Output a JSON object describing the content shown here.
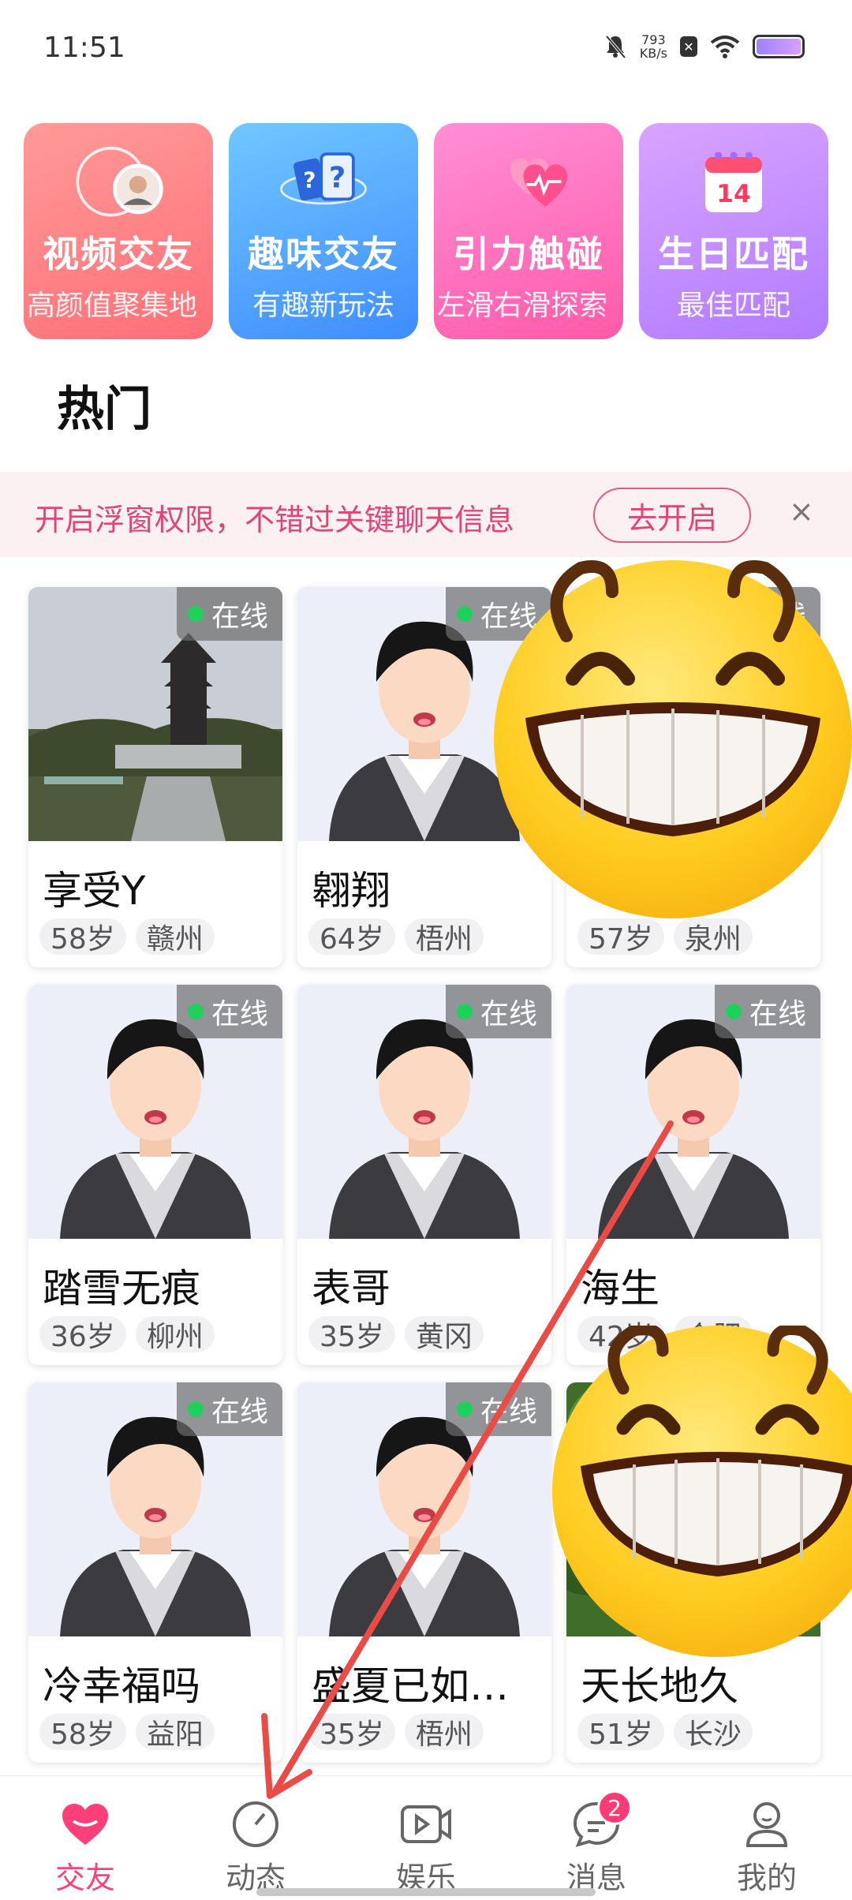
{
  "status_bar": {
    "time": "11:51",
    "speed_value": "793",
    "speed_unit": "KB/s"
  },
  "features": [
    {
      "title": "视频交友",
      "subtitle": "高颜值聚集地",
      "icon": "video-avatar-icon"
    },
    {
      "title": "趣味交友",
      "subtitle": "有趣新玩法",
      "icon": "question-cards-icon"
    },
    {
      "title": "引力触碰",
      "subtitle": "左滑右滑探索",
      "icon": "hearts-icon"
    },
    {
      "title": "生日匹配",
      "subtitle": "最佳匹配",
      "icon": "calendar-icon"
    }
  ],
  "calendar_day": "14",
  "section_title": "热门",
  "notice": {
    "text": "开启浮窗权限，不错过关键聊天信息",
    "button": "去开启",
    "close": "×"
  },
  "users": [
    {
      "name": "享受Y",
      "age": "58岁",
      "city": "赣州",
      "status": "在线",
      "photo": "landscape-photo"
    },
    {
      "name": "翱翔",
      "age": "64岁",
      "city": "梧州",
      "status": "在线",
      "photo": "default-avatar"
    },
    {
      "name": "",
      "age": "57岁",
      "city": "泉州",
      "status": "在线",
      "photo": "default-avatar"
    },
    {
      "name": "踏雪无痕",
      "age": "36岁",
      "city": "柳州",
      "status": "在线",
      "photo": "default-avatar"
    },
    {
      "name": "表哥",
      "age": "35岁",
      "city": "黄冈",
      "status": "在线",
      "photo": "default-avatar"
    },
    {
      "name": "海生",
      "age": "42岁",
      "city": "合肥",
      "status": "在线",
      "photo": "default-avatar"
    },
    {
      "name": "冷幸福吗",
      "age": "58岁",
      "city": "益阳",
      "status": "在线",
      "photo": "default-avatar"
    },
    {
      "name": "盛夏已如…",
      "age": "35岁",
      "city": "梧州",
      "status": "在线",
      "photo": "default-avatar"
    },
    {
      "name": "天长地久",
      "age": "51岁",
      "city": "长沙",
      "status": "",
      "photo": "green-photo"
    }
  ],
  "nav": [
    {
      "label": "交友",
      "icon": "heart-icon",
      "active": true
    },
    {
      "label": "动态",
      "icon": "compass-icon",
      "active": false
    },
    {
      "label": "娱乐",
      "icon": "video-play-icon",
      "active": false
    },
    {
      "label": "消息",
      "icon": "chat-icon",
      "active": false,
      "badge": "2"
    },
    {
      "label": "我的",
      "icon": "profile-icon",
      "active": false
    }
  ],
  "colors": {
    "accent": "#ff3f7a",
    "notice_text": "#e0457a",
    "online": "#1fd05b",
    "arrow": "#ea4b45"
  }
}
